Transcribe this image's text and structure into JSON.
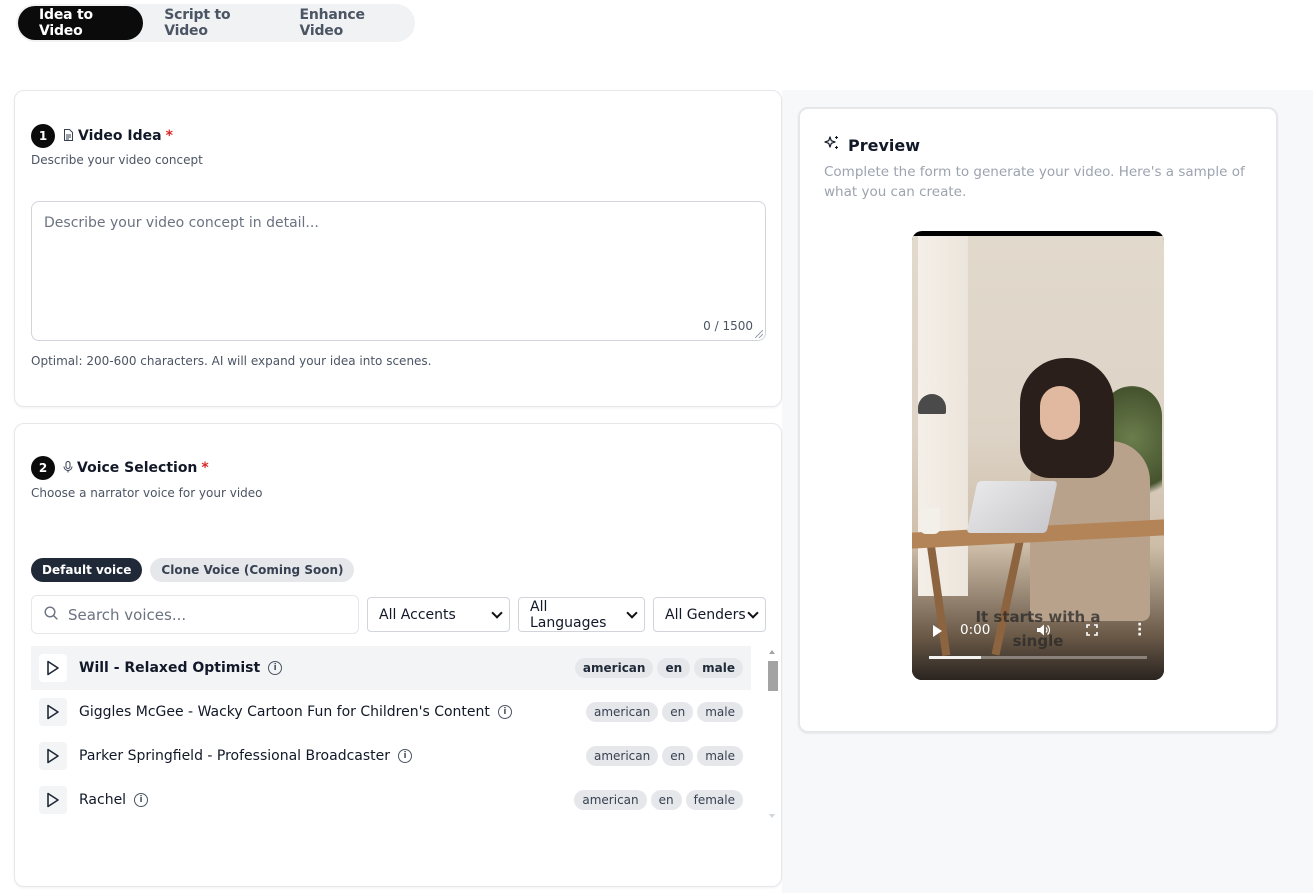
{
  "tabs": [
    {
      "label": "Idea to Video",
      "active": true
    },
    {
      "label": "Script to Video",
      "active": false
    },
    {
      "label": "Enhance Video",
      "active": false
    }
  ],
  "step1": {
    "number": "1",
    "title": "Video Idea",
    "required": "*",
    "subtitle": "Describe your video concept",
    "textarea": {
      "placeholder": "Describe your video concept in detail...",
      "counter": "0 / 1500"
    },
    "hint": "Optimal: 200-600 characters. AI will expand your idea into scenes."
  },
  "step2": {
    "number": "2",
    "title": "Voice Selection",
    "required": "*",
    "subtitle": "Choose a narrator voice for your video",
    "voice_tabs": [
      "Default voice",
      "Clone Voice (Coming Soon)"
    ],
    "search_placeholder": "Search voices...",
    "filters": [
      "All Accents",
      "All Languages",
      "All Genders"
    ],
    "voices": [
      {
        "name": "Will - Relaxed Optimist",
        "tags": [
          "american",
          "en",
          "male"
        ],
        "selected": true
      },
      {
        "name": "Giggles McGee - Wacky Cartoon Fun for Children's Content",
        "tags": [
          "american",
          "en",
          "male"
        ],
        "selected": false
      },
      {
        "name": "Parker Springfield - Professional Broadcaster",
        "tags": [
          "american",
          "en",
          "male"
        ],
        "selected": false
      },
      {
        "name": "Rachel",
        "tags": [
          "american",
          "en",
          "female"
        ],
        "selected": false
      }
    ]
  },
  "preview": {
    "title": "Preview",
    "description": "Complete the form to generate your video. Here's a sample of what you can create.",
    "video": {
      "caption_line1": "It starts with a",
      "caption_line2": "single",
      "time": "0:00",
      "progress": 0.24
    }
  },
  "icons": {
    "step1": "document-icon",
    "step2": "microphone-icon",
    "preview": "sparkles-icon",
    "search": "search-icon",
    "play": "play-icon",
    "info": "info-icon"
  },
  "colors": {
    "accent": "#0b0b0b",
    "required": "#dc2626"
  }
}
